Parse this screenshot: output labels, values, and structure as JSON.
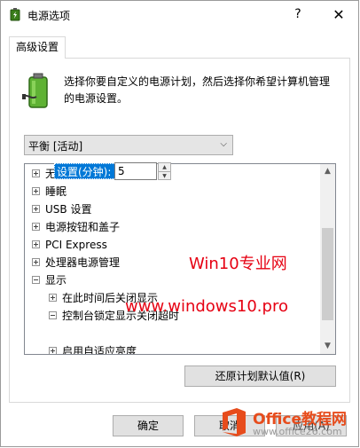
{
  "window": {
    "title": "电源选项",
    "help_glyph": "?",
    "close_glyph": "✕"
  },
  "tab": {
    "label": "高级设置"
  },
  "description": "选择你要自定义的电源计划，然后选择你希望计算机管理的电源设置。",
  "plan_select": {
    "value": "平衡 [活动]"
  },
  "tree": {
    "items": [
      {
        "label": "无线适配器设置",
        "expander": "+"
      },
      {
        "label": "睡眠",
        "expander": "+"
      },
      {
        "label": "USB 设置",
        "expander": "+"
      },
      {
        "label": "电源按钮和盖子",
        "expander": "+"
      },
      {
        "label": "PCI Express",
        "expander": "+"
      },
      {
        "label": "处理器电源管理",
        "expander": "+"
      },
      {
        "label": "显示",
        "expander": "-"
      },
      {
        "label": "在此时间后关闭显示",
        "expander": "+"
      },
      {
        "label": "控制台锁定显示关闭超时",
        "expander": "-"
      },
      {
        "label": "启用自适应亮度",
        "expander": "+"
      }
    ],
    "setting_label": "设置(分钟):",
    "setting_value": "5"
  },
  "buttons": {
    "restore": "还原计划默认值(R)",
    "ok": "确定",
    "cancel": "取消",
    "apply": "应用(A)"
  },
  "watermark": {
    "line1": "Win10专业网",
    "line2": "www.windows10.pro"
  },
  "office_logo": {
    "name": "Office教程网",
    "url": "www.office26.com"
  },
  "colors": {
    "selection": "#0078d7",
    "watermark": "#e60012",
    "office_orange": "#e74c1c"
  }
}
